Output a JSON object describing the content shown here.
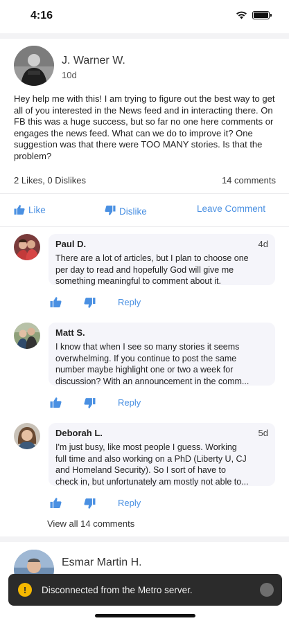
{
  "status_bar": {
    "time": "4:16"
  },
  "post": {
    "author": "J. Warner W.",
    "age": "10d",
    "body": "Hey help me with this! I am trying to figure out the best way to get all of you interested in the News feed and in interacting there. On FB this was a huge success, but so far no one here comments or engages the news feed. What can we do to improve it? One suggestion was that there were TOO MANY stories. Is that the problem?",
    "likes_dislikes": "2 Likes, 0 Dislikes",
    "comment_count": "14 comments",
    "actions": {
      "like": "Like",
      "dislike": "Dislike",
      "leave_comment": "Leave Comment"
    }
  },
  "comments": [
    {
      "name": "Paul D.",
      "time": "4d",
      "lines": [
        "There are a lot of articles, but I plan to choose one",
        "per day to read and hopefully God will give me",
        "something meaningful to comment about it."
      ],
      "reply": "Reply"
    },
    {
      "name": "Matt S.",
      "time": "",
      "lines": [
        "I know that when I see so many stories it seems",
        "overwhelming.  If you continue to post the same",
        "number maybe highlight one or two a week for",
        "discussion?  With an announcement in the comm..."
      ],
      "reply": "Reply"
    },
    {
      "name": "Deborah L.",
      "time": "5d",
      "lines": [
        "I'm just busy, like most people I guess.  Working",
        "full time and also working on a PhD (Liberty U, CJ",
        "and Homeland Security).  So I sort of have to",
        "check in, but unfortunately am mostly not able to..."
      ],
      "reply": "Reply"
    }
  ],
  "view_all": "View all 14 comments",
  "next_post": {
    "author": "Esmar Martin H."
  },
  "toast": {
    "icon": "!",
    "message": "Disconnected from the Metro server."
  },
  "colors": {
    "accent": "#4a90e2",
    "toast_bg": "#2b2b2b",
    "warning": "#f5b800"
  }
}
